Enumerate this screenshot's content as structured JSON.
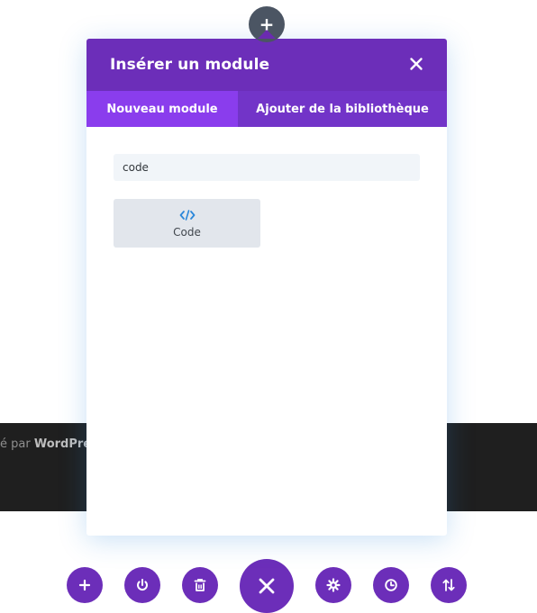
{
  "footer": {
    "credit_prefix": "é par ",
    "credit_brand": "WordPress"
  },
  "top_add_button": {
    "icon": "plus-icon",
    "label": "+"
  },
  "modal": {
    "title": "Insérer un module",
    "close_icon": "close-icon",
    "tabs": [
      {
        "label": "Nouveau module",
        "active": true
      },
      {
        "label": "Ajouter de la bibliothèque",
        "active": false
      }
    ],
    "search": {
      "value": "code",
      "placeholder": ""
    },
    "modules": [
      {
        "label": "Code",
        "icon": "code-icon"
      }
    ]
  },
  "toolbar": {
    "buttons": [
      {
        "icon": "plus-icon"
      },
      {
        "icon": "power-icon"
      },
      {
        "icon": "trash-icon"
      },
      {
        "icon": "close-icon"
      },
      {
        "icon": "gear-icon"
      },
      {
        "icon": "history-icon"
      },
      {
        "icon": "sort-icon"
      }
    ]
  },
  "colors": {
    "accent": "#6c2eb9",
    "tab_active": "#8a3ded",
    "tab_inactive": "#7234c8",
    "code_icon": "#2b87da",
    "footer_bg": "#1f1f1f"
  }
}
